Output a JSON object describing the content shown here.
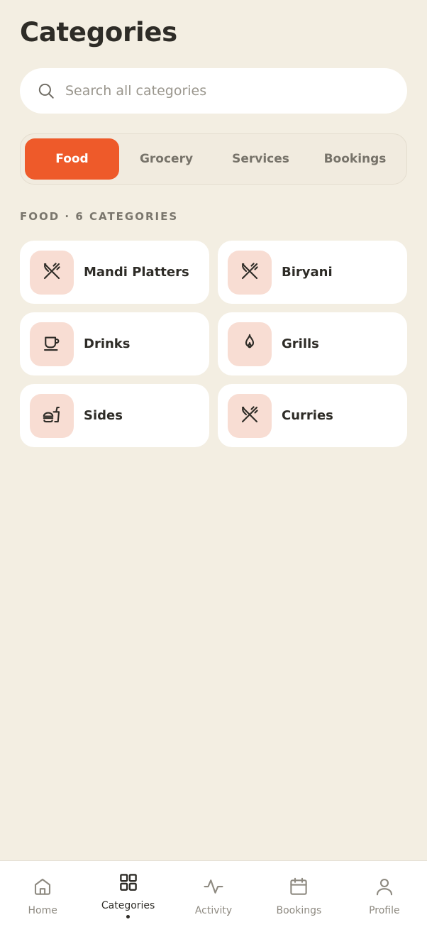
{
  "header": {
    "title": "Categories"
  },
  "search": {
    "placeholder": "Search all categories",
    "icon": "search-icon"
  },
  "tabs": [
    {
      "label": "Food",
      "active": true
    },
    {
      "label": "Grocery",
      "active": false
    },
    {
      "label": "Services",
      "active": false
    },
    {
      "label": "Bookings",
      "active": false
    }
  ],
  "section": {
    "label": "FOOD · 6 CATEGORIES"
  },
  "categories": [
    {
      "label": "Mandi Platters",
      "icon": "utensils-icon"
    },
    {
      "label": "Biryani",
      "icon": "utensils-icon"
    },
    {
      "label": "Drinks",
      "icon": "cup-icon"
    },
    {
      "label": "Grills",
      "icon": "flame-icon"
    },
    {
      "label": "Sides",
      "icon": "burger-drink-icon"
    },
    {
      "label": "Curries",
      "icon": "utensils-icon"
    }
  ],
  "nav": [
    {
      "label": "Home",
      "icon": "home-icon",
      "active": false
    },
    {
      "label": "Categories",
      "icon": "grid-icon",
      "active": true
    },
    {
      "label": "Activity",
      "icon": "activity-icon",
      "active": false
    },
    {
      "label": "Bookings",
      "icon": "calendar-icon",
      "active": false
    },
    {
      "label": "Profile",
      "icon": "user-icon",
      "active": false
    }
  ],
  "colors": {
    "background": "#F3EEE2",
    "accent": "#EE5A2A",
    "tile": "#F8DDD3",
    "text": "#2E2C27",
    "muted": "#8E8A81"
  }
}
